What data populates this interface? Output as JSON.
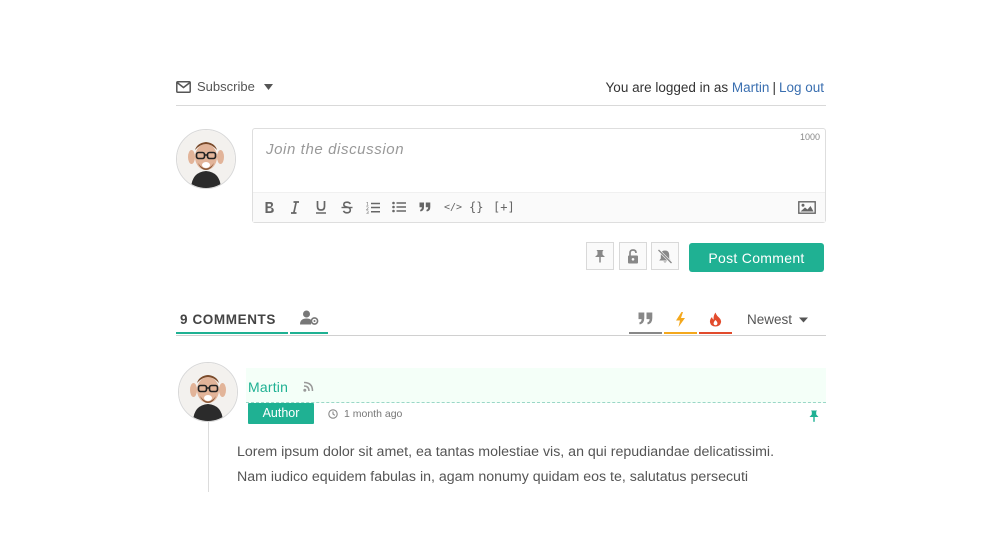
{
  "topbar": {
    "subscribe_label": "Subscribe",
    "logged_in_prefix": "You are logged in as",
    "username": "Martin",
    "separator": "|",
    "logout_label": "Log out"
  },
  "composer": {
    "placeholder": "Join the discussion",
    "char_limit": "1000",
    "toolbar_items": [
      "bold-icon",
      "italic-icon",
      "underline-icon",
      "strikethrough-icon",
      "ordered-list-icon",
      "unordered-list-icon",
      "quote-icon",
      "code-icon",
      "code-block-icon",
      "spoiler-icon",
      "image-icon"
    ],
    "code_label": "</>",
    "code_block_label": "{}",
    "spoiler_label": "[+]",
    "post_label": "Post Comment"
  },
  "comments_header": {
    "count_label": "9 COMMENTS",
    "sort_label": "Newest"
  },
  "colors": {
    "accent": "#1fb193",
    "link": "#3a6fb0",
    "bolt": "#f4a81d",
    "fire": "#e24b2c"
  },
  "comment": {
    "author": "Martin",
    "badge": "Author",
    "time": "1 month ago",
    "body_line1": "Lorem ipsum dolor sit amet, ea tantas molestiae vis, an qui repudiandae delicatissimi.",
    "body_line2": "Nam iudico equidem fabulas in, agam nonumy quidam eos te, salutatus persecuti"
  }
}
